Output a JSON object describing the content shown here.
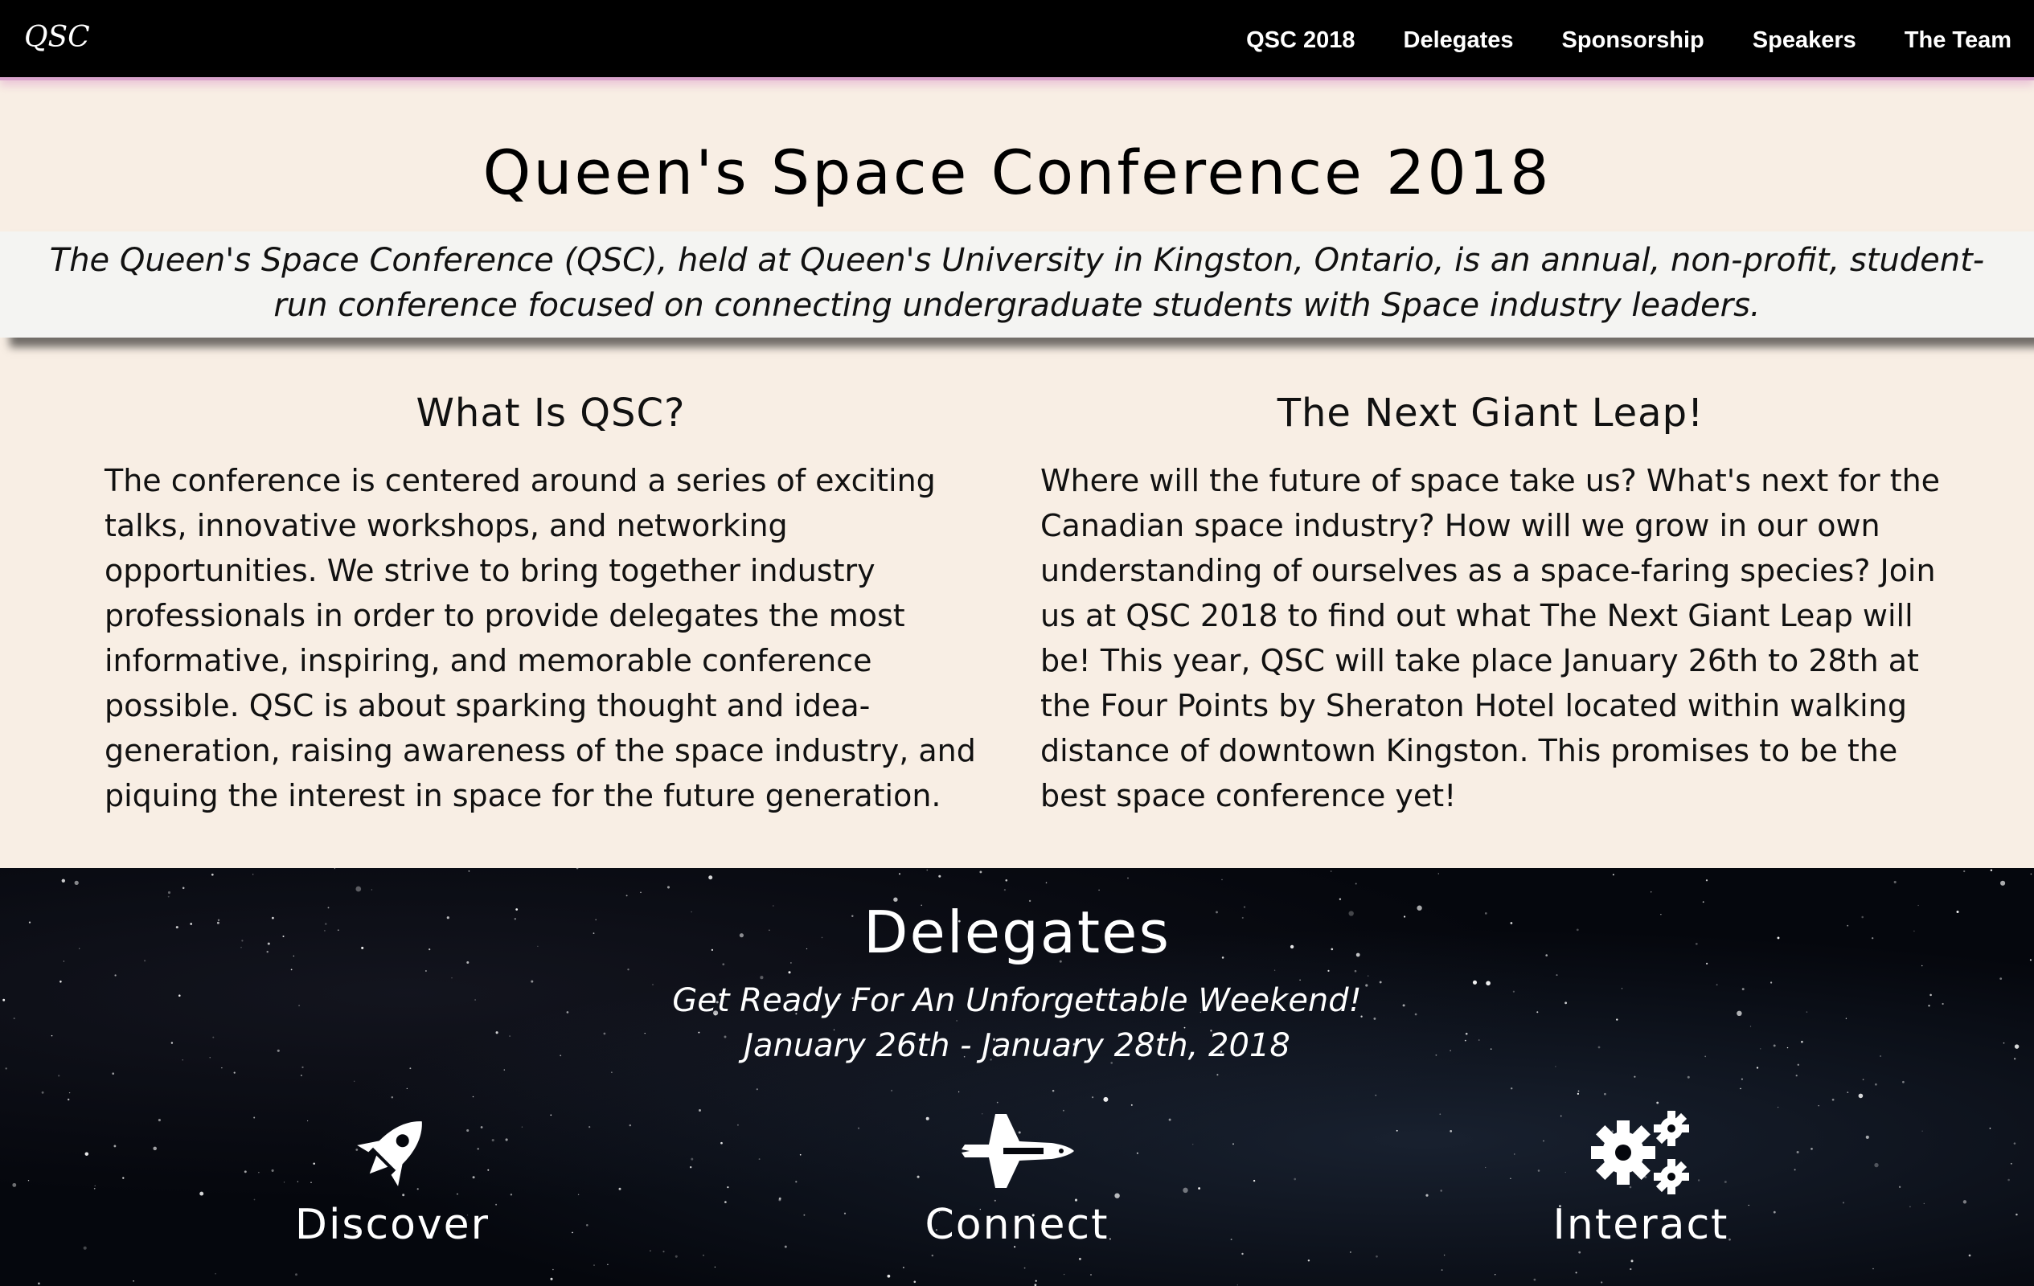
{
  "nav": {
    "brand": "QSC",
    "links": [
      "QSC 2018",
      "Delegates",
      "Sponsorship",
      "Speakers",
      "The Team"
    ]
  },
  "hero": {
    "title": "Queen's Space Conference 2018",
    "intro": "The Queen's Space Conference (QSC), held at Queen's University in Kingston, Ontario, is an annual, non-profit, student-run conference focused on connecting undergraduate students with Space industry leaders."
  },
  "about": {
    "left": {
      "heading": "What Is QSC?",
      "body": "The conference is centered around a series of exciting talks, innovative workshops, and networking opportunities. We strive to bring together industry professionals in order to provide delegates the most informative, inspiring, and memorable conference possible. QSC is about sparking thought and idea-generation, raising awareness of the space industry, and piquing the interest in space for the future generation."
    },
    "right": {
      "heading": "The Next Giant Leap!",
      "body": "Where will the future of space take us? What's next for the Canadian space industry? How will we grow in our own understanding of ourselves as a space-faring species? Join us at QSC 2018 to find out what The Next Giant Leap will be! This year, QSC will take place January 26th to 28th at the Four Points by Sheraton Hotel located within walking distance of downtown Kingston. This promises to be the best space conference yet!"
    }
  },
  "delegates": {
    "title": "Delegates",
    "tagline": "Get Ready For An Unforgettable Weekend!",
    "dates": "January 26th - January 28th, 2018",
    "features": [
      {
        "label": "Discover",
        "icon": "rocket-icon"
      },
      {
        "label": "Connect",
        "icon": "space-shuttle-icon"
      },
      {
        "label": "Interact",
        "icon": "gears-icon"
      }
    ]
  },
  "colors": {
    "navbar": "#000000",
    "navbar_glow": "#d9a4cc",
    "page_bg": "#f8eee4",
    "intro_band": "#f4f4f2",
    "space_bg": "#05070d"
  }
}
